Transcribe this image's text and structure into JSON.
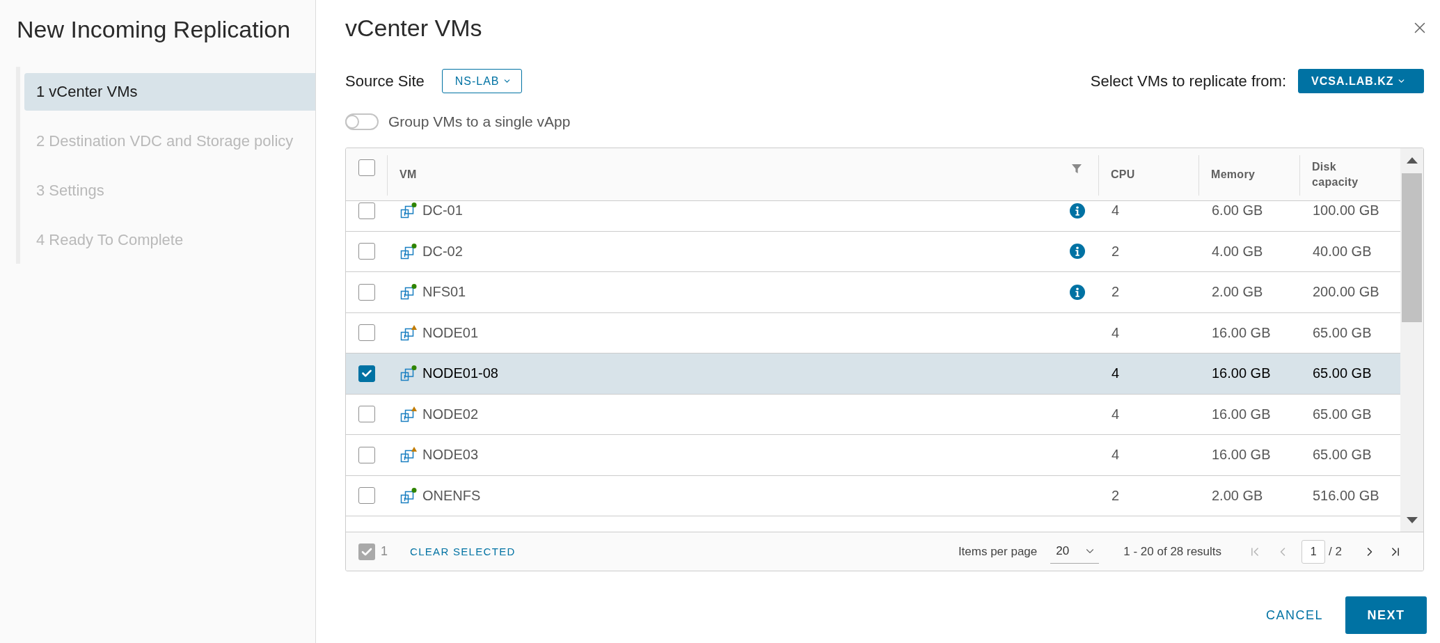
{
  "sidebar": {
    "title": "New Incoming Replication",
    "steps": [
      {
        "label": "1 vCenter VMs",
        "selected": true,
        "disabled": false
      },
      {
        "label": "2 Destination VDC and Storage policy",
        "selected": false,
        "disabled": true
      },
      {
        "label": "3 Settings",
        "selected": false,
        "disabled": true
      },
      {
        "label": "4 Ready To Complete",
        "selected": false,
        "disabled": true
      }
    ]
  },
  "dialog": {
    "title": "vCenter VMs"
  },
  "source_site": {
    "label": "Source Site",
    "value": "NS-LAB"
  },
  "vm_source": {
    "label": "Select VMs to replicate from:",
    "value": "VCSA.LAB.KZ"
  },
  "group_toggle": {
    "label": "Group VMs to a single vApp",
    "on": false
  },
  "table": {
    "select_all_checked": false,
    "columns": [
      {
        "label": "VM",
        "filter": true
      },
      {
        "label": "CPU",
        "filter": false
      },
      {
        "label": "Memory",
        "filter": false
      },
      {
        "label": "Disk capacity",
        "filter": false
      }
    ],
    "rows": [
      {
        "name": "DC-01",
        "kind": "running",
        "info": true,
        "cpu": "4",
        "memory": "6.00 GB",
        "disk": "100.00 GB",
        "selected": false
      },
      {
        "name": "DC-02",
        "kind": "running",
        "info": true,
        "cpu": "2",
        "memory": "4.00 GB",
        "disk": "40.00 GB",
        "selected": false
      },
      {
        "name": "NFS01",
        "kind": "running",
        "info": true,
        "cpu": "2",
        "memory": "2.00 GB",
        "disk": "200.00 GB",
        "selected": false
      },
      {
        "name": "NODE01",
        "kind": "warning",
        "info": false,
        "cpu": "4",
        "memory": "16.00 GB",
        "disk": "65.00 GB",
        "selected": false
      },
      {
        "name": "NODE01-08",
        "kind": "running",
        "info": false,
        "cpu": "4",
        "memory": "16.00 GB",
        "disk": "65.00 GB",
        "selected": true
      },
      {
        "name": "NODE02",
        "kind": "warning",
        "info": false,
        "cpu": "4",
        "memory": "16.00 GB",
        "disk": "65.00 GB",
        "selected": false
      },
      {
        "name": "NODE03",
        "kind": "warning",
        "info": false,
        "cpu": "4",
        "memory": "16.00 GB",
        "disk": "65.00 GB",
        "selected": false
      },
      {
        "name": "ONENFS",
        "kind": "running",
        "info": false,
        "cpu": "2",
        "memory": "2.00 GB",
        "disk": "516.00 GB",
        "selected": false
      }
    ],
    "footer": {
      "selected_count": "1",
      "clear_label": "CLEAR SELECTED",
      "items_per_page_label": "Items per page",
      "items_per_page": "20",
      "range": "1 - 20 of 28 results",
      "page": "1",
      "page_total": "/ 2",
      "pager": [
        {
          "kind": "first",
          "disabled": true
        },
        {
          "kind": "prev",
          "disabled": true
        },
        {
          "kind": "next",
          "disabled": false
        },
        {
          "kind": "last",
          "disabled": false
        }
      ]
    }
  },
  "buttons": [
    {
      "label": "CANCEL",
      "kind": "flat"
    },
    {
      "label": "NEXT",
      "kind": "primary"
    }
  ]
}
